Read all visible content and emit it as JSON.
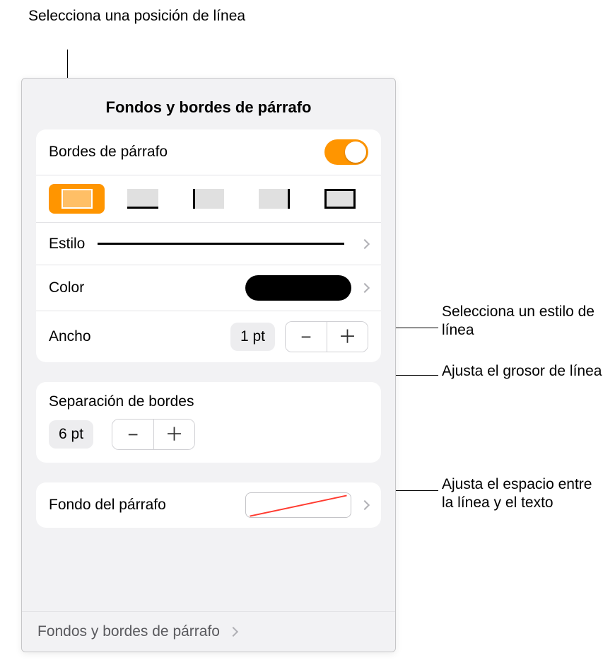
{
  "callouts": {
    "position": "Selecciona una posición de línea",
    "style": "Selecciona un estilo de línea",
    "width": "Ajusta el grosor de línea",
    "offset": "Ajusta el espacio entre la línea y el texto"
  },
  "panel": {
    "title": "Fondos y bordes de párrafo",
    "toggle_label": "Bordes de párrafo",
    "positions": [
      "all",
      "bottom",
      "left",
      "right",
      "box"
    ],
    "active_position": 0,
    "style_label": "Estilo",
    "color_label": "Color",
    "color_value": "#000000",
    "width_label": "Ancho",
    "width_value": "1 pt",
    "offset_section": "Separación de bordes",
    "offset_value": "6 pt",
    "bg_label": "Fondo del párrafo",
    "bg_value": "none",
    "footer_label": "Fondos y bordes de párrafo"
  }
}
